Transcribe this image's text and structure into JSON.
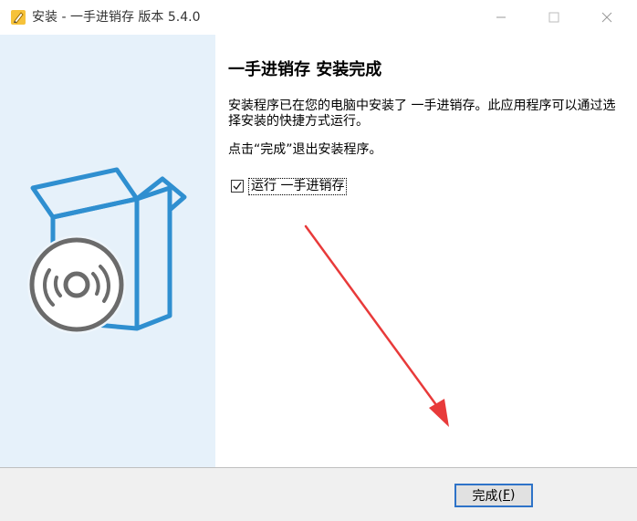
{
  "window": {
    "title": "安装 - 一手进销存 版本 5.4.0",
    "icon": "installer-pencil-icon",
    "controls": [
      "minimize",
      "maximize",
      "close"
    ]
  },
  "content": {
    "heading": "一手进销存 安装完成",
    "description": "安装程序已在您的电脑中安装了 一手进销存。此应用程序可以通过选择安装的快捷方式运行。",
    "hint": "点击“完成”退出安装程序。",
    "run_checkbox": {
      "label": "运行 一手进销存",
      "checked": true
    }
  },
  "footer": {
    "finish_label": "完成(",
    "finish_accel": "F",
    "finish_close": ")"
  },
  "colors": {
    "sidebar_bg": "#e6f1fa",
    "box_blue": "#2f8fd0",
    "disc_gray": "#666666",
    "arrow_red": "#e83a3a",
    "button_focus": "#2e73c8"
  }
}
